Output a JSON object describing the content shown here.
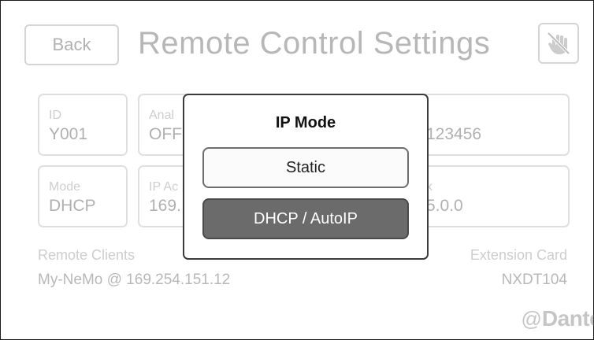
{
  "header": {
    "back_label": "Back",
    "title": "Remote Control Settings",
    "mute_icon": "hand-blocked-icon"
  },
  "fields": {
    "id": {
      "label": "ID",
      "value": "Y001"
    },
    "analog": {
      "label": "Anal",
      "value": "OFF"
    },
    "serial": {
      "label": "",
      "value": "123456"
    },
    "mode": {
      "label": "Mode",
      "value": "DHCP"
    },
    "ip_address": {
      "label": "IP Ac",
      "value": "169."
    },
    "netmask": {
      "label": "k",
      "value": "5.0.0"
    }
  },
  "remote_clients": {
    "label": "Remote Clients",
    "value": "My-NeMo @ 169.254.151.12"
  },
  "extension_card": {
    "label": "Extension Card",
    "value": "NXDT104"
  },
  "logo": {
    "text": "Dante"
  },
  "modal": {
    "title": "IP Mode",
    "options": [
      {
        "label": "Static",
        "selected": false
      },
      {
        "label": "DHCP / AutoIP",
        "selected": true
      }
    ]
  }
}
